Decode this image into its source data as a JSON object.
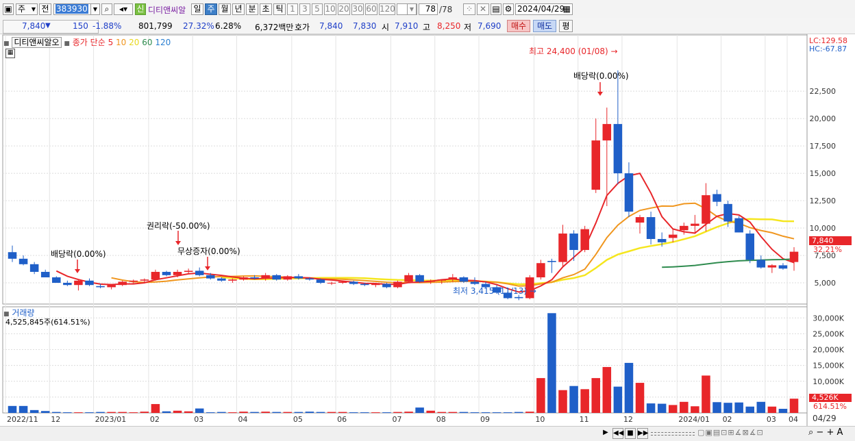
{
  "toolbar": {
    "market": "주",
    "prefix": "전",
    "code": "383930",
    "new_badge": "신",
    "stock_name": "디티앤씨알",
    "periods": [
      "일",
      "주",
      "월",
      "년",
      "분",
      "초",
      "틱"
    ],
    "active_period": "주",
    "intervals": [
      "1",
      "3",
      "5",
      "10",
      "20",
      "30",
      "60",
      "120"
    ],
    "count_value": "78",
    "count_total": "/78",
    "date": "2024/04/29"
  },
  "quote": {
    "price": "7,840",
    "direction": "▼",
    "change": "150",
    "change_pct": "-1.88%",
    "volume": "801,799",
    "turnover_pct": "27.32%",
    "weight": "6.28%",
    "amount": "6,372백만",
    "ask_label": "호가",
    "ask": "7,840",
    "bid": "7,830",
    "open_label": "시",
    "open": "7,910",
    "high_label": "고",
    "high": "8,250",
    "low_label": "저",
    "low": "7,690",
    "buy_button": "매수",
    "sell_button": "매도",
    "eval_button": "평"
  },
  "legend": {
    "name": "디티앤씨알오",
    "label": "종가 단순",
    "ma_periods": [
      "5",
      "10",
      "20",
      "60",
      "120"
    ]
  },
  "lc": "LC:129.58",
  "hc": "HC:-67.87",
  "price_tag": "7,840",
  "price_pct": "32.21%",
  "volume_panel": {
    "title": "거래량",
    "info": "4,525,845주(614.51%)",
    "tag": "4,526K",
    "pct": "614.51%"
  },
  "annotations": {
    "high": "최고 24,400 (01/08)",
    "low": "최저 3,415 (11/13)",
    "div1": "배당락(0.00%)",
    "rights": "권리락(-50.00%)",
    "bonus": "무상증자(0.00%)",
    "div2": "배당락(0.00%)"
  },
  "xaxis": [
    "2022/11",
    "12",
    "2023/01",
    "02",
    "03",
    "04",
    "05",
    "06",
    "07",
    "08",
    "09",
    "10",
    "11",
    "12",
    "2024/01",
    "02",
    "03",
    "04"
  ],
  "last_date": "04/29",
  "colors": {
    "up": "#e8262a",
    "down": "#1f5fc8",
    "ma5": "#e8262a",
    "ma10": "#f0961e",
    "ma20": "#f5e61e",
    "ma60": "#2e8b4e",
    "ma120": "#2a7fd1"
  },
  "chart_data": {
    "type": "candlestick",
    "x_labels": [
      "2022/11",
      "12",
      "2023/01",
      "02",
      "03",
      "04",
      "05",
      "06",
      "07",
      "08",
      "09",
      "10",
      "11",
      "12",
      "2024/01",
      "02",
      "03",
      "04"
    ],
    "y_ticks": [
      5000,
      7500,
      10000,
      12500,
      15000,
      17500,
      20000,
      22500
    ],
    "volume_ticks": [
      "5,000K",
      "10,000K",
      "15,000K",
      "20,000K",
      "25,000K",
      "30,000K"
    ],
    "candles": [
      [
        7800,
        8400,
        6900,
        7200
      ],
      [
        7200,
        7500,
        6600,
        6700
      ],
      [
        6700,
        6900,
        5800,
        6000
      ],
      [
        6000,
        6200,
        5500,
        5500
      ],
      [
        5500,
        5600,
        5000,
        5000
      ],
      [
        5000,
        5200,
        4700,
        4800
      ],
      [
        4800,
        5300,
        4300,
        5200
      ],
      [
        5200,
        5400,
        4700,
        4800
      ],
      [
        4700,
        4900,
        4500,
        4600
      ],
      [
        4600,
        4900,
        4400,
        4800
      ],
      [
        4800,
        5200,
        4700,
        5100
      ],
      [
        5100,
        5300,
        4900,
        5200
      ],
      [
        5200,
        5400,
        5000,
        5300
      ],
      [
        5300,
        6200,
        5200,
        6000
      ],
      [
        6000,
        6100,
        5600,
        5700
      ],
      [
        5700,
        6200,
        5500,
        6000
      ],
      [
        6000,
        6300,
        5800,
        6100
      ],
      [
        6100,
        6400,
        5600,
        5700
      ],
      [
        5700,
        5900,
        5300,
        5400
      ],
      [
        5400,
        5500,
        5100,
        5200
      ],
      [
        5200,
        5400,
        5000,
        5300
      ],
      [
        5300,
        5600,
        5200,
        5500
      ],
      [
        5500,
        5700,
        5300,
        5400
      ],
      [
        5400,
        5900,
        5200,
        5700
      ],
      [
        5700,
        5800,
        5200,
        5300
      ],
      [
        5300,
        5700,
        5200,
        5600
      ],
      [
        5600,
        5800,
        5300,
        5400
      ],
      [
        5400,
        5500,
        5200,
        5300
      ],
      [
        5300,
        5400,
        4900,
        5000
      ],
      [
        5000,
        5100,
        4800,
        5000
      ],
      [
        5000,
        5200,
        4900,
        5100
      ],
      [
        5100,
        5200,
        4800,
        4900
      ],
      [
        4900,
        5000,
        4700,
        4800
      ],
      [
        4800,
        5000,
        4600,
        4900
      ],
      [
        4900,
        5000,
        4500,
        4600
      ],
      [
        4600,
        5200,
        4500,
        5100
      ],
      [
        5100,
        5900,
        5000,
        5700
      ],
      [
        5700,
        5800,
        5000,
        5100
      ],
      [
        5100,
        5300,
        4900,
        5200
      ],
      [
        5200,
        5300,
        4900,
        5300
      ],
      [
        5300,
        5800,
        5100,
        5500
      ],
      [
        5500,
        5600,
        5000,
        5100
      ],
      [
        5100,
        5500,
        4800,
        4900
      ],
      [
        4900,
        5100,
        4500,
        4600
      ],
      [
        4600,
        4800,
        4000,
        4100
      ],
      [
        4100,
        4200,
        3500,
        3600
      ],
      [
        3700,
        3900,
        3415,
        3600
      ],
      [
        3600,
        5700,
        3500,
        5500
      ],
      [
        5500,
        7100,
        5300,
        6800
      ],
      [
        7000,
        7200,
        5900,
        6900
      ],
      [
        6900,
        10300,
        6500,
        9500
      ],
      [
        9500,
        9800,
        7000,
        8000
      ],
      [
        8000,
        10200,
        7800,
        9900
      ],
      [
        13500,
        20000,
        13200,
        18000
      ],
      [
        18000,
        21000,
        12000,
        19500
      ],
      [
        19500,
        24400,
        14000,
        15000
      ],
      [
        15000,
        16000,
        11000,
        11500
      ],
      [
        10500,
        11200,
        9500,
        11000
      ],
      [
        11000,
        11500,
        8500,
        9000
      ],
      [
        9000,
        9600,
        8300,
        8700
      ],
      [
        9100,
        10000,
        8700,
        9400
      ],
      [
        9800,
        10500,
        9400,
        10200
      ],
      [
        10200,
        11200,
        9600,
        10400
      ],
      [
        10400,
        14100,
        9700,
        13000
      ],
      [
        13100,
        13500,
        12000,
        12400
      ],
      [
        12200,
        12500,
        10100,
        10600
      ],
      [
        10900,
        11100,
        9600,
        9600
      ],
      [
        9500,
        9800,
        6800,
        7100
      ],
      [
        7100,
        7500,
        6300,
        6400
      ],
      [
        6400,
        6700,
        5900,
        6600
      ],
      [
        6600,
        6800,
        6200,
        6300
      ],
      [
        6900,
        8250,
        6100,
        7840
      ]
    ],
    "volume_k": [
      2200,
      2200,
      900,
      600,
      300,
      200,
      200,
      200,
      300,
      300,
      300,
      200,
      400,
      2800,
      500,
      700,
      500,
      1400,
      200,
      300,
      200,
      400,
      300,
      400,
      300,
      300,
      300,
      400,
      300,
      300,
      300,
      200,
      200,
      200,
      200,
      300,
      400,
      1700,
      700,
      300,
      300,
      300,
      200,
      200,
      200,
      200,
      300,
      400,
      11000,
      31500,
      7200,
      8500,
      7500,
      11000,
      14500,
      8300,
      15800,
      9500,
      3000,
      2900,
      2500,
      3500,
      2100,
      11800,
      3400,
      3200,
      3300,
      2000,
      3500,
      2000,
      1300,
      4500
    ]
  }
}
